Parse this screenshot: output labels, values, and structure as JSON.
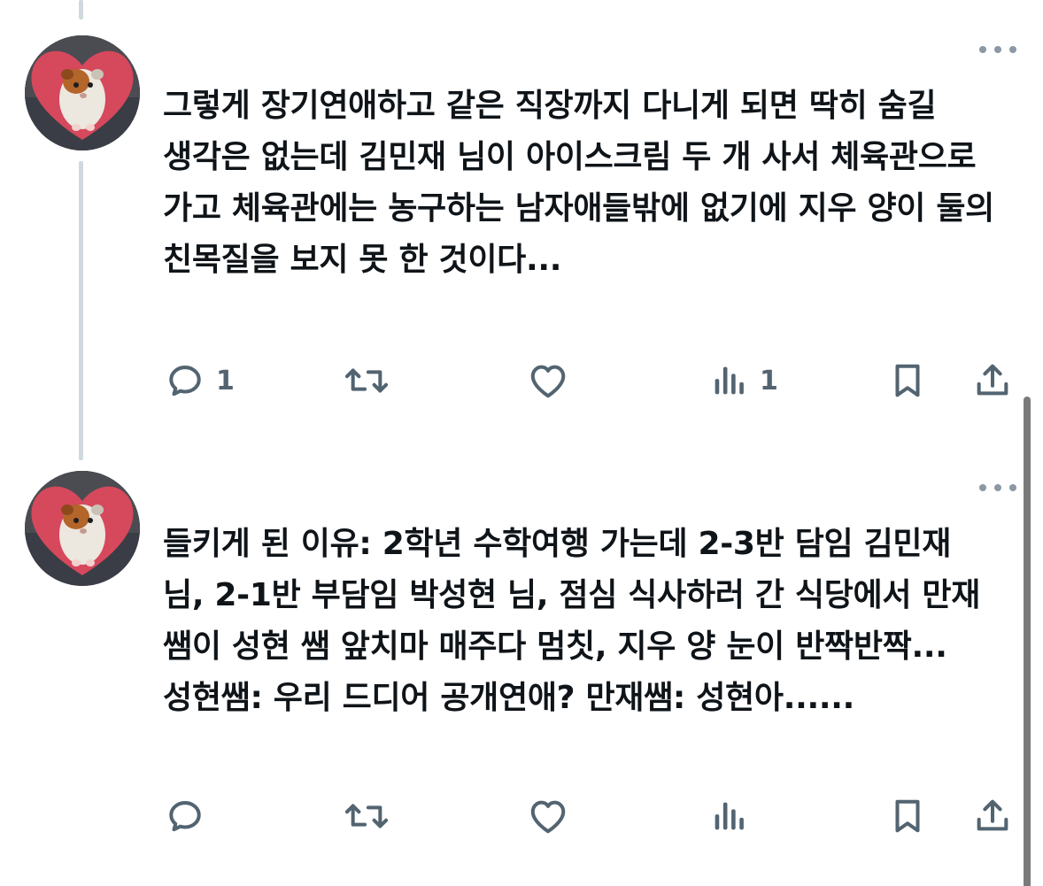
{
  "tweets": [
    {
      "text": "그렇게 장기연애하고 같은 직장까지 다니게 되면 딱히 숨길 생각은 없는데 김민재 님이 아이스크림 두 개 사서 체육관으로 가고 체육관에는 농구하는 남자애들밖에 없기에 지우 양이 둘의 친목질을 보지 못 한 것이다...",
      "actions": {
        "reply_count": "1",
        "retweet_count": "",
        "like_count": "",
        "views_count": "1"
      }
    },
    {
      "text": "들키게 된 이유: 2학년 수학여행 가는데 2-3반 담임 김민재 님, 2-1반 부담임 박성현 님, 점심 식사하러 간 식당에서 만재 쌤이 성현 쌤 앞치마 매주다 멈칫, 지우 양 눈이 반짝반짝... 성현쌤: 우리 드디어 공개연애? 만재쌤: 성현아......",
      "actions": {
        "reply_count": "",
        "retweet_count": "",
        "like_count": "",
        "views_count": ""
      }
    }
  ],
  "icons": {
    "reply": "reply-icon",
    "retweet": "retweet-icon",
    "like": "heart-icon",
    "views": "views-icon",
    "bookmark": "bookmark-icon",
    "share": "share-icon",
    "more": "more-icon",
    "avatar": "guinea-pig-avatar"
  },
  "colors": {
    "text": "#0f1419",
    "icon": "#536471",
    "thread_line": "#cfd9de",
    "avatar_heart": "#d6485c"
  }
}
